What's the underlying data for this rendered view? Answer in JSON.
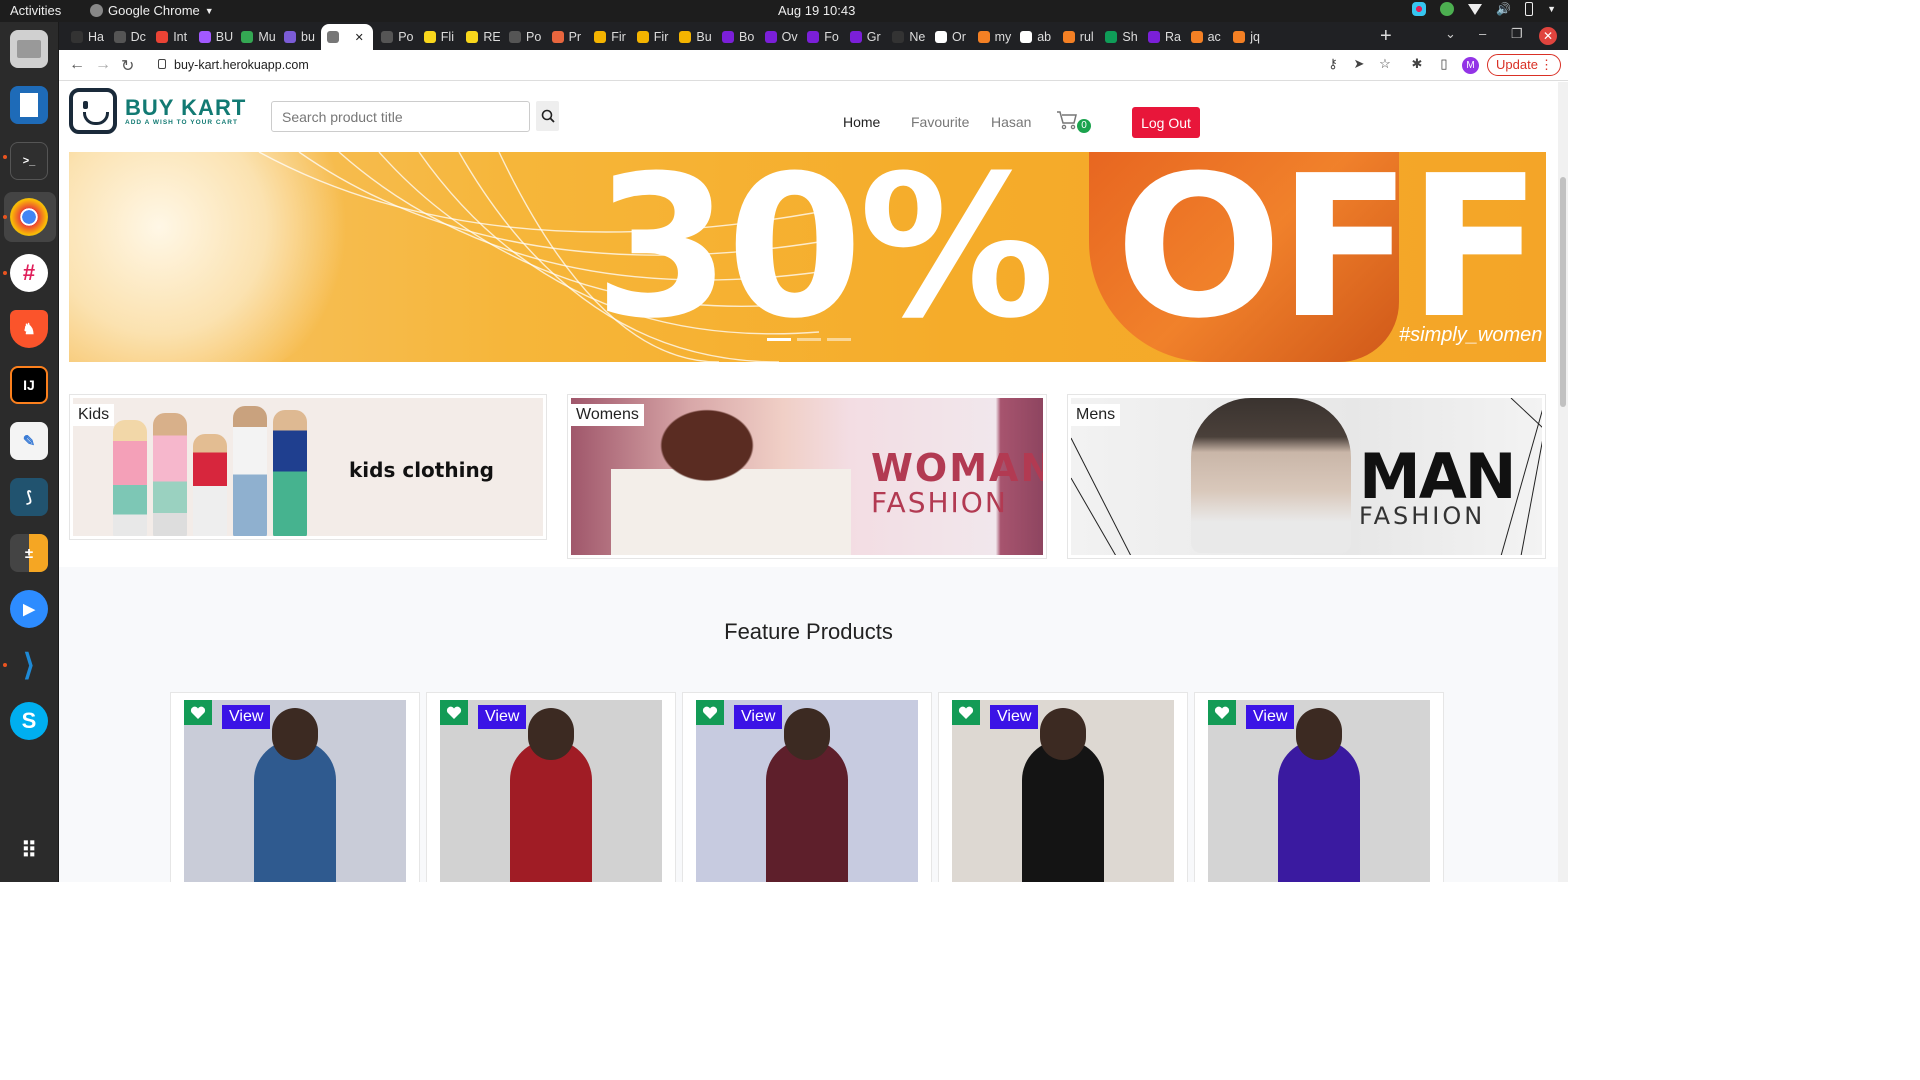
{
  "system": {
    "activities": "Activities",
    "app_name": "Google Chrome",
    "clock": "Aug 19  10:43"
  },
  "browser": {
    "tabs": [
      {
        "label": "Ha",
        "color": "#333333"
      },
      {
        "label": "Dc",
        "color": "#555555"
      },
      {
        "label": "Int",
        "color": "#ea4335"
      },
      {
        "label": "BU",
        "color": "#a259ff"
      },
      {
        "label": "Mu",
        "color": "#34a853"
      },
      {
        "label": "bu",
        "color": "#7b5cd6"
      },
      {
        "label": "",
        "color": "#777777"
      },
      {
        "label": "Po",
        "color": "#555555"
      },
      {
        "label": "Fli",
        "color": "#f9d71c"
      },
      {
        "label": "RE",
        "color": "#f9d71c"
      },
      {
        "label": "Po",
        "color": "#555555"
      },
      {
        "label": "Pr",
        "color": "#e8663e"
      },
      {
        "label": "Fir",
        "color": "#f4b400"
      },
      {
        "label": "Fir",
        "color": "#f4b400"
      },
      {
        "label": "Bu",
        "color": "#f4b400"
      },
      {
        "label": "Bo",
        "color": "#7b1fd9"
      },
      {
        "label": "Ov",
        "color": "#7b1fd9"
      },
      {
        "label": "Fo",
        "color": "#7b1fd9"
      },
      {
        "label": "Gr",
        "color": "#7b1fd9"
      },
      {
        "label": "Ne",
        "color": "#333333"
      },
      {
        "label": "Or",
        "color": "#ffffff"
      },
      {
        "label": "my",
        "color": "#f48024"
      },
      {
        "label": "ab",
        "color": "#ffffff"
      },
      {
        "label": "rul",
        "color": "#f48024"
      },
      {
        "label": "Sh",
        "color": "#0f9d58"
      },
      {
        "label": "Ra",
        "color": "#7b1fd9"
      },
      {
        "label": "ac",
        "color": "#f48024"
      },
      {
        "label": "jq",
        "color": "#f48024"
      }
    ],
    "url": "buy-kart.herokuapp.com",
    "profile_initial": "M",
    "update_label": "Update"
  },
  "site": {
    "brand": "BUY KART",
    "tagline": "ADD A WISH TO YOUR CART",
    "search_placeholder": "Search product title",
    "nav": {
      "home": "Home",
      "favourite": "Favourite",
      "user": "Hasan",
      "cart_count": "0",
      "logout": "Log Out"
    }
  },
  "banner": {
    "headline": "30% OFF",
    "hashtag": "#simply_women",
    "slide_count": 3,
    "active_slide": 1
  },
  "categories": [
    {
      "label": "Kids",
      "art_text": "kids clothing"
    },
    {
      "label": "Womens",
      "art_text_1": "WOMAN",
      "art_text_2": "FASHION"
    },
    {
      "label": "Mens",
      "art_text_1": "MAN",
      "art_text_2": "FASHION"
    }
  ],
  "featured": {
    "title": "Feature Products",
    "products": [
      {
        "view_label": "View",
        "dress_color": "#2f5a8f",
        "bg": "#c9ccd8"
      },
      {
        "view_label": "View",
        "dress_color": "#a01c25",
        "bg": "#d2d2d2"
      },
      {
        "view_label": "View",
        "dress_color": "#5e1f2b",
        "bg": "#c7cbe0"
      },
      {
        "view_label": "View",
        "dress_color": "#141414",
        "bg": "#ddd8d2"
      },
      {
        "view_label": "View",
        "dress_color": "#3a1aa0",
        "bg": "#d4d4d4"
      }
    ]
  },
  "dock": [
    {
      "name": "files-icon",
      "color": "#c9c9c9"
    },
    {
      "name": "writer-icon",
      "color": "#1e6bb8"
    },
    {
      "name": "terminal-icon",
      "color": "#2b2b2b"
    },
    {
      "name": "chrome-icon",
      "color": "#4285f4"
    },
    {
      "name": "slack-icon",
      "color": "#ffffff"
    },
    {
      "name": "brave-icon",
      "color": "#fb542b"
    },
    {
      "name": "intellij-icon",
      "color": "#000000"
    },
    {
      "name": "text-editor-icon",
      "color": "#f4f4f4"
    },
    {
      "name": "mysql-workbench-icon",
      "color": "#21536f"
    },
    {
      "name": "calculator-icon",
      "color": "#f5a623"
    },
    {
      "name": "zoom-icon",
      "color": "#2d8cff"
    },
    {
      "name": "vscode-icon",
      "color": "#1e8ad6"
    },
    {
      "name": "skype-icon",
      "color": "#00aff0"
    },
    {
      "name": "app-grid-icon",
      "color": "#2b2b2b"
    }
  ]
}
